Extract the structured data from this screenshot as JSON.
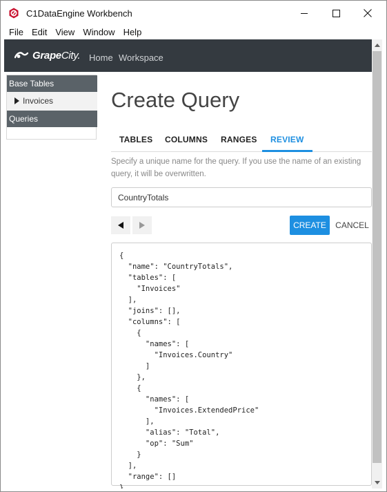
{
  "window": {
    "title": "C1DataEngine Workbench",
    "icon": "c1-app-icon",
    "controls": [
      "minimize-icon",
      "maximize-icon",
      "close-icon"
    ]
  },
  "menubar": {
    "items": [
      "File",
      "Edit",
      "View",
      "Window",
      "Help"
    ]
  },
  "navbar": {
    "logo_main": "Grape",
    "logo_accent": "City.",
    "links": [
      "Home",
      "Workspace"
    ],
    "background": "#343a40"
  },
  "sidebar": {
    "base_tables_header": "Base Tables",
    "items": [
      "Invoices"
    ],
    "queries_header": "Queries"
  },
  "main": {
    "title": "Create Query",
    "tabs": [
      "TABLES",
      "COLUMNS",
      "RANGES",
      "REVIEW"
    ],
    "active_tab": "REVIEW",
    "hint": "Specify a unique name for the query. If you use the name of an existing query, it will be overwritten.",
    "query_name_value": "CountryTotals",
    "create_label": "CREATE",
    "cancel_label": "CANCEL",
    "json_preview": "{\n  \"name\": \"CountryTotals\",\n  \"tables\": [\n    \"Invoices\"\n  ],\n  \"joins\": [],\n  \"columns\": [\n    {\n      \"names\": [\n        \"Invoices.Country\"\n      ]\n    },\n    {\n      \"names\": [\n        \"Invoices.ExtendedPrice\"\n      ],\n      \"alias\": \"Total\",\n      \"op\": \"Sum\"\n    }\n  ],\n  \"range\": []\n}"
  },
  "colors": {
    "accent": "#1d8fe1",
    "sidebar_header": "#5a6268",
    "app_icon": "#c8102e"
  }
}
